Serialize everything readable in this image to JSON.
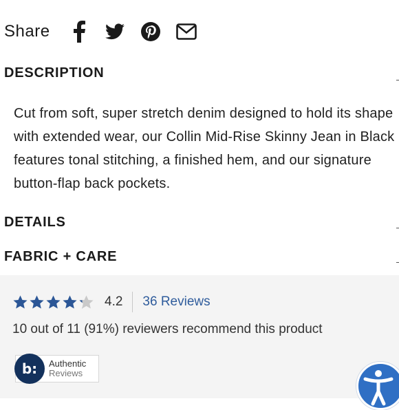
{
  "share": {
    "label": "Share",
    "icons": [
      "facebook-icon",
      "twitter-icon",
      "pinterest-icon",
      "email-icon"
    ]
  },
  "sections": {
    "description": {
      "title": "DESCRIPTION",
      "text": "Cut from soft, super stretch denim designed to hold its shape with extended wear, our Collin Mid-Rise Skinny Jean in Black features tonal stitching, a finished hem, and our signature button-flap back pockets."
    },
    "details": {
      "title": "DETAILS"
    },
    "fabric_care": {
      "title": "FABRIC + CARE"
    }
  },
  "reviews": {
    "rating": "4.2",
    "rating_value": 4.2,
    "rating_max": 5,
    "count_label": "36 Reviews",
    "recommend": "10 out of 11 (91%) reviewers recommend this product",
    "badge": {
      "logo": "b:",
      "line1": "Authentic",
      "line2": "Reviews"
    }
  },
  "colors": {
    "star": "#2b5696",
    "star_empty": "#c9c9c9",
    "link": "#2f5c9c",
    "review_bg": "#f4f4f4",
    "badge_logo": "#13315c",
    "accessibility_button": "#2f6fc4"
  },
  "accessibility_button": {
    "icon": "accessibility-icon"
  }
}
